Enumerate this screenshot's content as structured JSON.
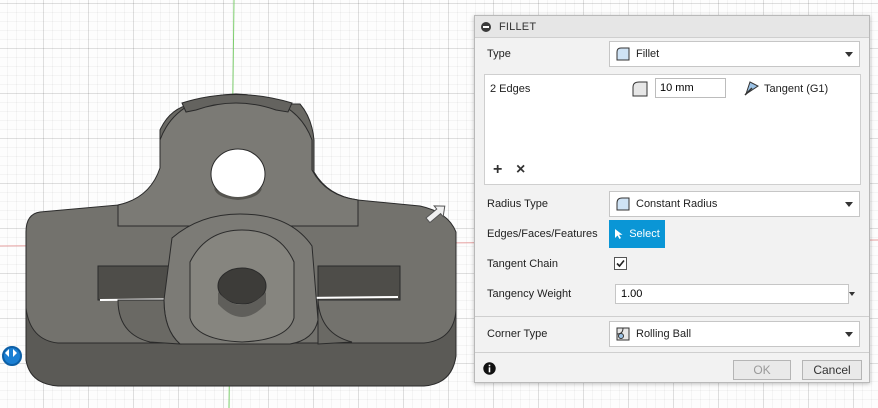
{
  "dialog": {
    "title": "FILLET",
    "type_label": "Type",
    "type_value": "Fillet",
    "selection": {
      "edges_text": "2 Edges",
      "radius_value": "10 mm",
      "continuity_value": "Tangent (G1)",
      "add_symbol": "+",
      "remove_symbol": "×"
    },
    "radius_type_label": "Radius Type",
    "radius_type_value": "Constant Radius",
    "edges_faces_label": "Edges/Faces/Features",
    "select_label": "Select",
    "tangent_chain_label": "Tangent Chain",
    "tangent_chain_checked": true,
    "tangency_weight_label": "Tangency Weight",
    "tangency_weight_value": "1.00",
    "corner_type_label": "Corner Type",
    "corner_type_value": "Rolling Ball",
    "info_icon": "info-icon",
    "ok_label": "OK",
    "cancel_label": "Cancel"
  },
  "colors": {
    "accent": "#0a96d6",
    "model_face": "#6f6e69",
    "model_side": "#5a5955",
    "grid": "#dcdcdc"
  }
}
